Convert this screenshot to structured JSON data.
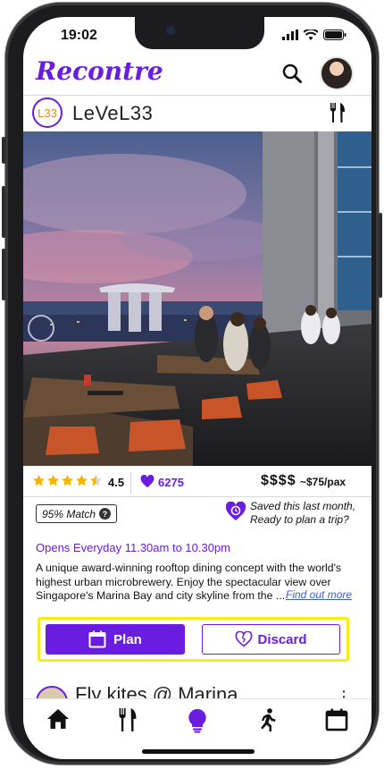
{
  "status_bar": {
    "time": "19:02"
  },
  "header": {
    "app_name": "Recontre"
  },
  "venue": {
    "badge": "L33",
    "name": "LeVeL33",
    "rating": "4.5",
    "stars_fraction": 0.9,
    "likes": "6275",
    "price_symbols": "$$$$",
    "price_avg": "~$75/pax",
    "match": "95% Match",
    "saved_note": "Saved this last month, Ready to plan a trip?",
    "hours": "Opens Everyday 11.30am to 10.30pm",
    "description": "A unique award-winning rooftop dining concept with the world's highest urban microbrewery. Enjoy the spectacular view over Singapore's Marina Bay and city skyline from the ...",
    "find_more": "Find out more"
  },
  "actions": {
    "plan": "Plan",
    "discard": "Discard"
  },
  "next_card": {
    "title": "Fly kites @ Marina"
  },
  "icons": {
    "search": "search-icon",
    "cutlery": "cutlery-icon",
    "heart": "heart-icon",
    "calendar": "calendar-icon",
    "home": "home-icon",
    "bulb": "lightbulb-icon",
    "run": "running-icon"
  },
  "colors": {
    "accent": "#6a1de0",
    "highlight": "#f6ec1a",
    "star": "#f5b400"
  },
  "tabs": [
    "home",
    "food",
    "ideas",
    "activities",
    "calendar"
  ]
}
